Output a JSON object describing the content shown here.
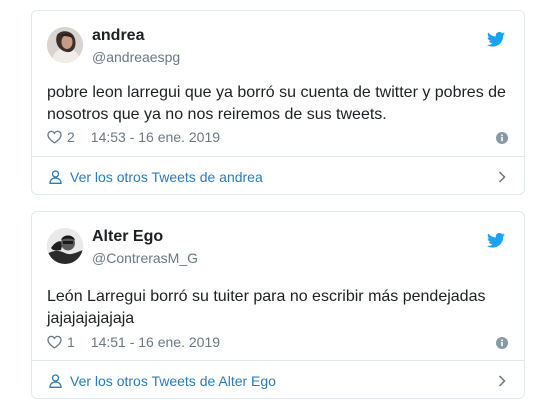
{
  "tweets": [
    {
      "name": "andrea",
      "handle": "@andreaespg",
      "text": "pobre leon larregui que ya borró su cuenta de twitter y pobres de nosotros que ya no nos reiremos de sus tweets.",
      "likes": "2",
      "timestamp": "14:53 - 16 ene. 2019",
      "footer_link": "Ver los otros Tweets de andrea",
      "icons": {
        "brand": "twitter-bird-icon",
        "like": "heart-icon",
        "info": "info-icon",
        "profile": "person-icon",
        "chevron": "chevron-right-icon"
      }
    },
    {
      "name": "Alter Ego",
      "handle": "@ContrerasM_G",
      "text": "León Larregui borró su tuiter para no escribir más pendejadas jajajajajajaja",
      "likes": "1",
      "timestamp": "14:51 - 16 ene. 2019",
      "footer_link": "Ver los otros Tweets de Alter Ego",
      "icons": {
        "brand": "twitter-bird-icon",
        "like": "heart-icon",
        "info": "info-icon",
        "profile": "person-icon",
        "chevron": "chevron-right-icon"
      }
    }
  ],
  "colors": {
    "brand_blue": "#1da1f2",
    "link_blue": "#2b7bb9",
    "secondary_text": "#697882",
    "primary_text": "#1c2022",
    "border": "#e1e8ed"
  }
}
